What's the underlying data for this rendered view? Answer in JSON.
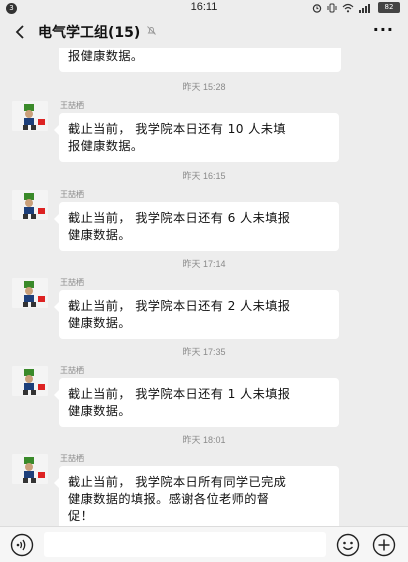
{
  "status_bar": {
    "notification_count": "3",
    "time": "16:11",
    "battery": "82"
  },
  "header": {
    "title": "电气学工组(15)"
  },
  "messages": [
    {
      "text_lines": [
        "报健康数据。"
      ]
    },
    {
      "timestamp": "昨天 15:28",
      "sender": "王喆栖",
      "text_lines": [
        "截止当前， 我学院本日还有 10 人未填",
        "报健康数据。"
      ]
    },
    {
      "timestamp": "昨天 16:15",
      "sender": "王喆栖",
      "text_lines": [
        "截止当前， 我学院本日还有 6 人未填报",
        "健康数据。"
      ]
    },
    {
      "timestamp": "昨天 17:14",
      "sender": "王喆栖",
      "text_lines": [
        "截止当前， 我学院本日还有 2 人未填报",
        "健康数据。"
      ]
    },
    {
      "timestamp": "昨天 17:35",
      "sender": "王喆栖",
      "text_lines": [
        "截止当前， 我学院本日还有 1 人未填报",
        "健康数据。"
      ]
    },
    {
      "timestamp": "昨天 18:01",
      "sender": "王喆栖",
      "text_lines": [
        "截止当前， 我学院本日所有同学已完成",
        "健康数据的填报。感谢各位老师的督",
        "促！"
      ]
    }
  ],
  "input": {
    "placeholder": ""
  },
  "icons": {
    "back": "back-arrow-icon",
    "mute": "mute-bell-icon",
    "more": "more-dots-icon",
    "voice": "voice-icon",
    "emoji": "emoji-icon",
    "plus": "plus-icon"
  }
}
